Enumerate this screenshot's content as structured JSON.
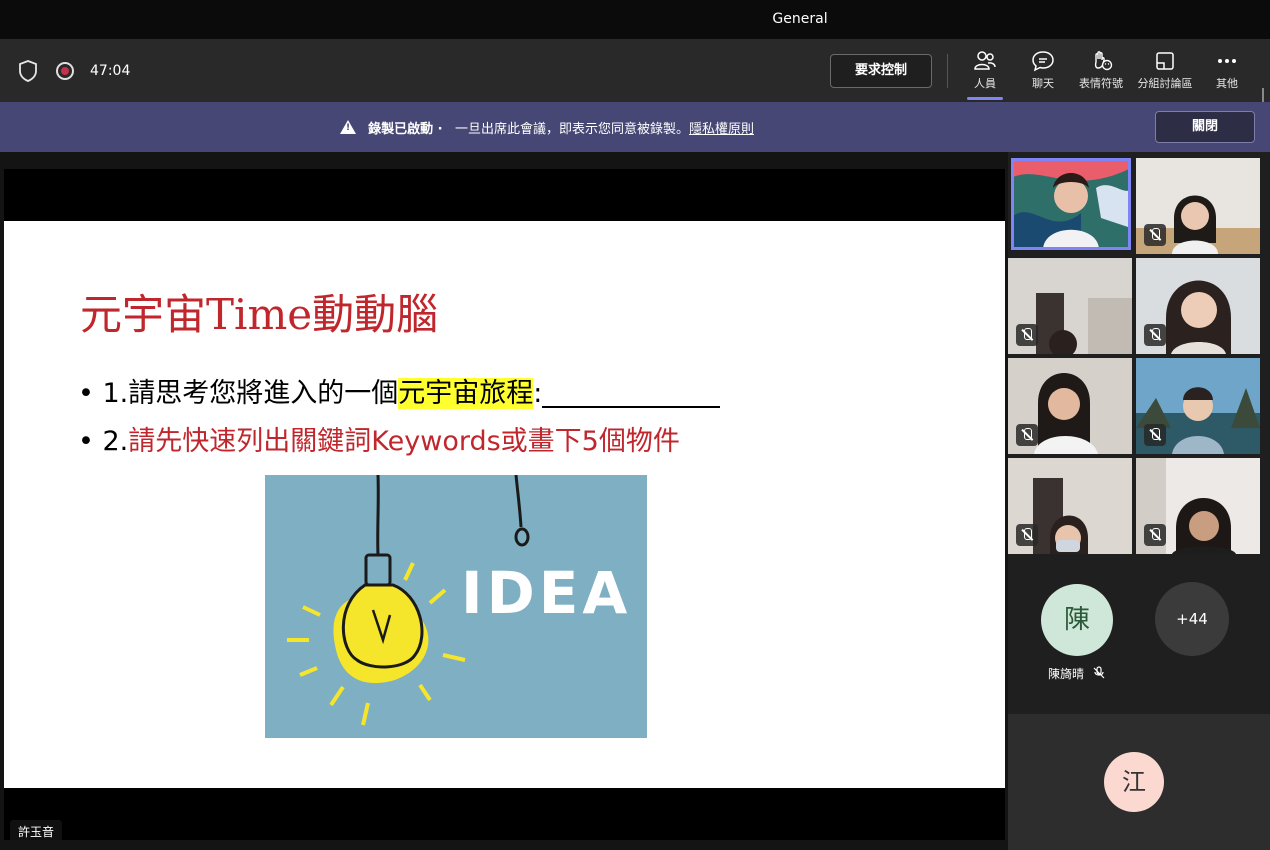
{
  "window": {
    "title": "General"
  },
  "toolbar": {
    "timer": "47:04",
    "request_control": "要求控制",
    "items": [
      {
        "label": "人員",
        "icon": "people-icon",
        "active": true
      },
      {
        "label": "聊天",
        "icon": "chat-icon",
        "active": false
      },
      {
        "label": "表情符號",
        "icon": "reactions-icon",
        "active": false
      },
      {
        "label": "分組討論區",
        "icon": "breakout-rooms-icon",
        "active": false
      },
      {
        "label": "其他",
        "icon": "more-icon",
        "active": false
      }
    ]
  },
  "banner": {
    "bold": "錄製已啟動 ·",
    "message": "一旦出席此會議，即表示您同意被錄製。",
    "link": "隱私權原則",
    "close": "關閉"
  },
  "slide": {
    "title": "元宇宙Time動動腦",
    "bullet1_prefix": "• 1.請思考您將進入的一個",
    "bullet1_highlight": "元宇宙旅程",
    "bullet1_suffix": ":",
    "bullet2_prefix": "• 2.",
    "bullet2_text": "請先快速列出關鍵詞Keywords或畫下5個物件",
    "image_text": "IDEA"
  },
  "presenter": {
    "name": "許玉音"
  },
  "gallery": {
    "participant_name": "陳旖晴",
    "participant_initial": "陳",
    "overflow": "+44",
    "bottom_initial": "江"
  },
  "colors": {
    "accent": "#7f85f5",
    "banner": "#464775",
    "slide_red": "#c0272d",
    "highlight": "#ffff2f",
    "avatar_green": "#cfe7d8",
    "avatar_pink": "#fbd9d1"
  }
}
